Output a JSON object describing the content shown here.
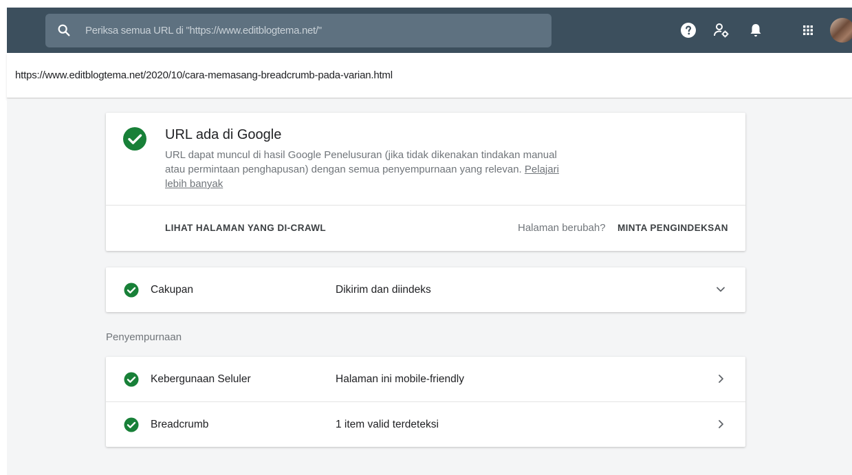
{
  "topbar": {
    "search_placeholder": "Periksa semua URL di \"https://www.editblogtema.net/\"",
    "icons": [
      "search-icon",
      "help-icon",
      "admin-settings-icon",
      "notifications-icon",
      "apps-grid-icon",
      "avatar"
    ],
    "background_color": "#3c4f5d"
  },
  "inspected_url": "https://www.editblogtema.net/2020/10/cara-memasang-breadcrumb-pada-varian.html",
  "status_card": {
    "title": "URL ada di Google",
    "description": "URL dapat muncul di hasil Google Penelusuran (jika tidak dikenakan tindakan manual atau permintaan penghapusan) dengan semua penyempurnaan yang relevan.",
    "learn_more": "Pelajari lebih banyak",
    "view_crawled": "LIHAT HALAMAN YANG DI-CRAWL",
    "page_changed": "Halaman berubah?",
    "request_indexing": "MINTA PENGINDEKSAN",
    "status_color": "#188038"
  },
  "coverage": {
    "label": "Cakupan",
    "value": "Dikirim dan diindeks"
  },
  "enhancements": {
    "section_label": "Penyempurnaan",
    "items": [
      {
        "label": "Kebergunaan Seluler",
        "value": "Halaman ini mobile-friendly"
      },
      {
        "label": "Breadcrumb",
        "value": "1 item valid terdeteksi"
      }
    ]
  }
}
